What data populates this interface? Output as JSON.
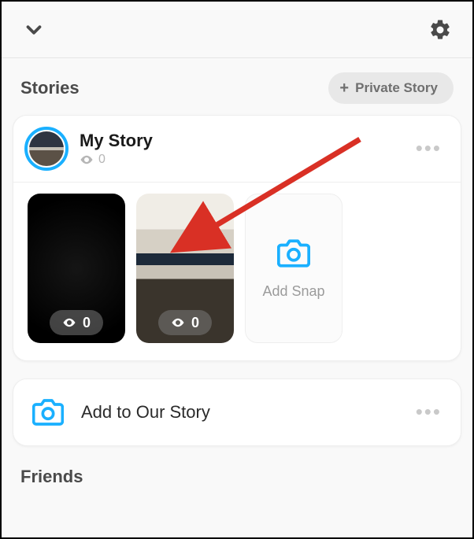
{
  "header": {
    "chevron_icon": "chevron-down",
    "settings_icon": "gear"
  },
  "stories_section": {
    "title": "Stories",
    "private_button": {
      "plus": "+",
      "label": "Private Story"
    }
  },
  "my_story_card": {
    "title": "My Story",
    "view_count": "0",
    "more_icon": "more-horizontal",
    "snaps": [
      {
        "view_count": "0"
      },
      {
        "view_count": "0"
      }
    ],
    "add_tile": {
      "label": "Add Snap",
      "icon": "camera"
    }
  },
  "our_story_card": {
    "title": "Add to Our Story",
    "icon": "camera",
    "more_icon": "more-horizontal"
  },
  "friends_section": {
    "title": "Friends"
  }
}
